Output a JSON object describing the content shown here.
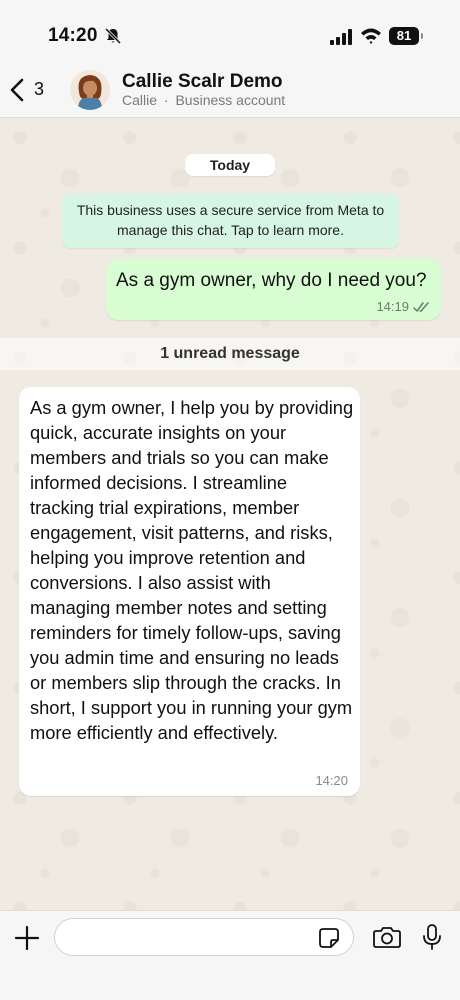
{
  "status_bar": {
    "time": "14:20",
    "battery": "81",
    "icons": [
      "bell-muted-icon",
      "cellular-signal-icon",
      "wifi-icon",
      "battery-icon"
    ]
  },
  "header": {
    "back_count": "3",
    "contact_name": "Callie Scalr Demo",
    "subtitle_name": "Callie",
    "subtitle_type": "Business account"
  },
  "chat": {
    "date_pill": "Today",
    "notice": "This business uses a secure service from Meta to manage this chat. Tap to learn more.",
    "messages": [
      {
        "direction": "outgoing",
        "text": "As a gym owner, why do I need you?",
        "time": "14:19",
        "status": "read"
      },
      {
        "direction": "incoming",
        "text": "As a gym owner, I help you by providing quick, accurate insights on your members and trials so you can make informed decisions. I streamline tracking trial expirations, member engagement, visit patterns, and risks, helping you improve retention and conversions. I also assist with managing member notes and setting reminders for timely follow-ups, saving you admin time and ensuring no leads or members slip through the cracks. In short, I support you in running your gym more efficiently and effectively.",
        "time": "14:20"
      }
    ],
    "unread_label": "1 unread message"
  },
  "composer": {
    "input_value": "",
    "input_placeholder": ""
  },
  "colors": {
    "chat_bg": "#efeae2",
    "outgoing_bubble": "#d9fdd3",
    "notice_bg": "#d6f5e3",
    "read_ticks": "#53bdeb"
  }
}
